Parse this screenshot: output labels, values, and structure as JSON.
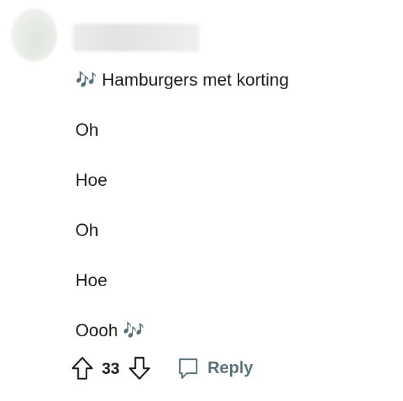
{
  "comment": {
    "lines": [
      "🎶 Hamburgers met korting",
      "Oh",
      "Hoe",
      "Oh",
      "Hoe",
      "Oooh 🎶"
    ]
  },
  "actions": {
    "vote_count": "33",
    "reply_label": "Reply"
  },
  "icons": {
    "upvote": "arrow-up-outline-icon",
    "downvote": "arrow-down-outline-icon",
    "reply": "speech-bubble-icon"
  },
  "colors": {
    "text": "#1a1a1b",
    "muted": "#576f76",
    "icon": "#1a1a1b"
  }
}
